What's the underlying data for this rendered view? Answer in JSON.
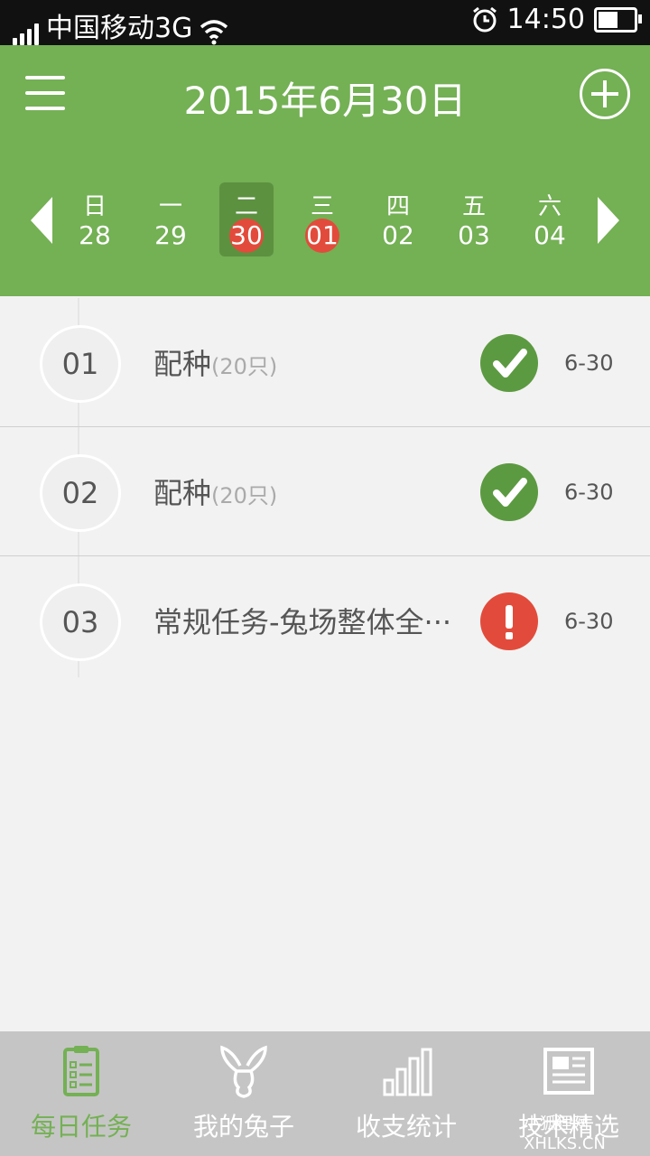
{
  "status": {
    "carrier": "中国移动3G",
    "time": "14:50",
    "battery_level": 0.55
  },
  "header": {
    "title": "2015年6月30日",
    "menu_icon": "menu-icon",
    "add_icon": "plus-circle-icon"
  },
  "calendar": {
    "days": [
      {
        "weekday": "日",
        "date": "28",
        "selected": false,
        "marked": false
      },
      {
        "weekday": "一",
        "date": "29",
        "selected": false,
        "marked": false
      },
      {
        "weekday": "二",
        "date": "30",
        "selected": true,
        "marked": true
      },
      {
        "weekday": "三",
        "date": "01",
        "selected": false,
        "marked": true
      },
      {
        "weekday": "四",
        "date": "02",
        "selected": false,
        "marked": false
      },
      {
        "weekday": "五",
        "date": "03",
        "selected": false,
        "marked": false
      },
      {
        "weekday": "六",
        "date": "04",
        "selected": false,
        "marked": false
      }
    ]
  },
  "tasks": [
    {
      "num": "01",
      "name": "配种",
      "count": "(20只)",
      "status": "done",
      "date": "6-30"
    },
    {
      "num": "02",
      "name": "配种",
      "count": "(20只)",
      "status": "done",
      "date": "6-30"
    },
    {
      "num": "03",
      "name": "常规任务-兔场整体全···",
      "count": "",
      "status": "warning",
      "date": "6-30"
    }
  ],
  "tabs": [
    {
      "label": "每日任务",
      "icon": "clipboard-icon",
      "active": true
    },
    {
      "label": "我的兔子",
      "icon": "rabbit-icon",
      "active": false
    },
    {
      "label": "收支统计",
      "icon": "bar-chart-icon",
      "active": false
    },
    {
      "label": "技术精选",
      "icon": "newspaper-icon",
      "active": false
    }
  ],
  "watermark": "小狐狸网 XHLKS.CN",
  "colors": {
    "green": "#74b054",
    "red": "#e24b3b",
    "ok": "#5c9a41"
  }
}
